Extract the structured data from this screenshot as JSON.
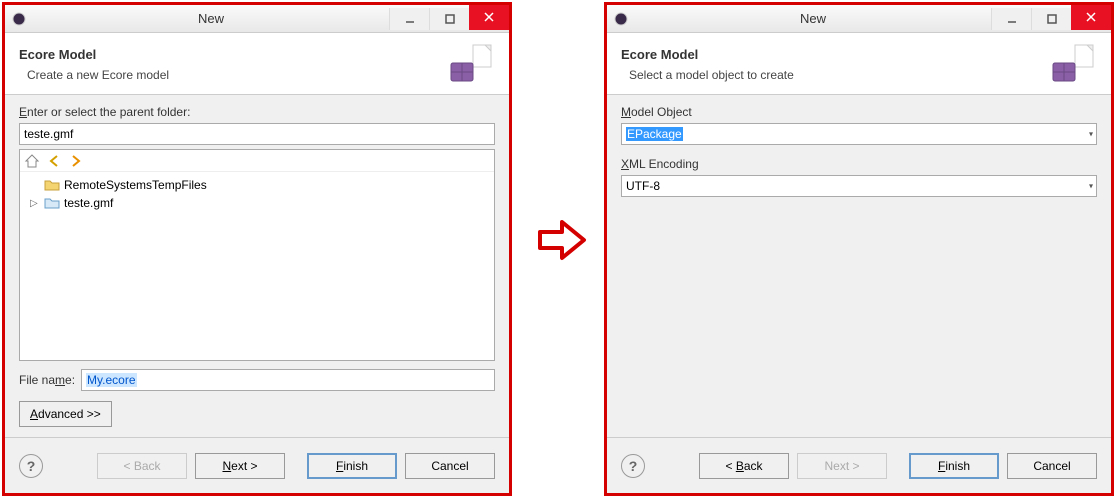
{
  "left_dialog": {
    "title": "New",
    "banner_title": "Ecore Model",
    "banner_desc": "Create a new Ecore model",
    "parent_folder_label_pre": "",
    "parent_folder_label_underline": "E",
    "parent_folder_label_post": "nter or select the parent folder:",
    "parent_folder_value": "teste.gmf",
    "tree_items": [
      {
        "label": "RemoteSystemsTempFiles",
        "expandable": false,
        "indent": 1
      },
      {
        "label": "teste.gmf",
        "expandable": true,
        "indent": 0
      }
    ],
    "filename_label_pre": "File na",
    "filename_label_underline": "m",
    "filename_label_post": "e:",
    "filename_value": "My.ecore",
    "advanced_label_underline": "A",
    "advanced_label_post": "dvanced >>",
    "buttons": {
      "back": "< Back",
      "next_underline": "N",
      "next_post": "ext >",
      "finish_underline": "F",
      "finish_post": "inish",
      "cancel": "Cancel"
    }
  },
  "right_dialog": {
    "title": "New",
    "banner_title": "Ecore Model",
    "banner_desc": "Select a model object to create",
    "model_object_label_underline": "M",
    "model_object_label_post": "odel Object",
    "model_object_value": "EPackage",
    "xml_encoding_label_underline": "X",
    "xml_encoding_label_post": "ML Encoding",
    "xml_encoding_value": "UTF-8",
    "buttons": {
      "back_pre": "< ",
      "back_underline": "B",
      "back_post": "ack",
      "next_underline": "N",
      "next_post": "ext >",
      "finish_underline": "F",
      "finish_post": "inish",
      "cancel": "Cancel"
    }
  }
}
